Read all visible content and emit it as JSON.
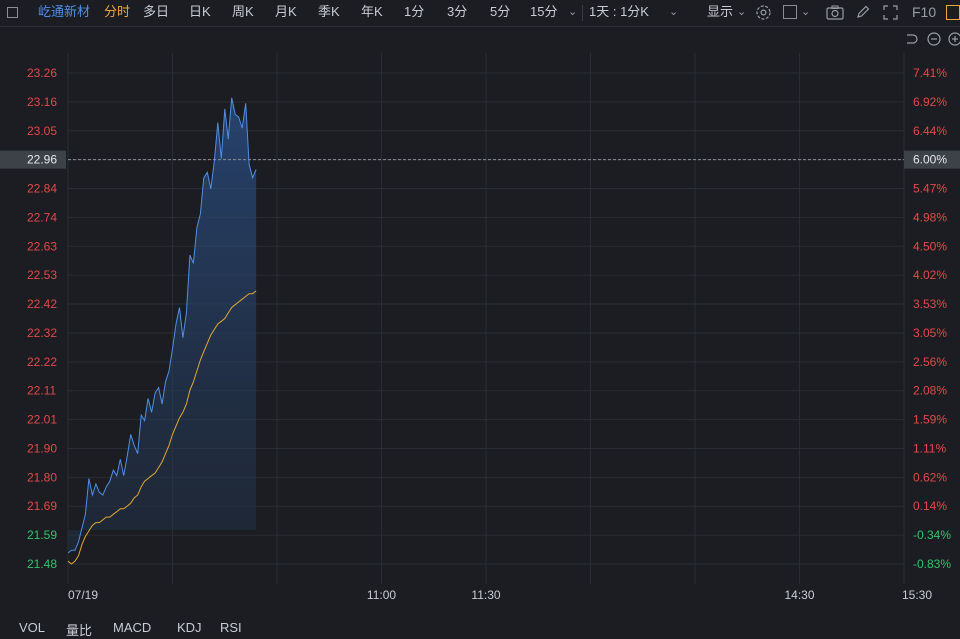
{
  "toolbar": {
    "stock_name": "屹通新材",
    "periods": [
      "分时",
      "多日",
      "日K",
      "周K",
      "月K",
      "季K",
      "年K",
      "1分",
      "3分",
      "5分",
      "15分"
    ],
    "range_select": "1天 : 1分K",
    "display_label": "显示",
    "f10_label": "F10"
  },
  "colors": {
    "background": "#1b1d22",
    "price_line": "#4f8ee8",
    "avg_line": "#e3a72f",
    "up_text": "#e54848",
    "down_text": "#32c36c",
    "active_tab": "#f0a63a",
    "stock_name": "#4f8ee8"
  },
  "chart_data": {
    "type": "line",
    "prev_close": 21.66,
    "y_ticks_left": [
      "23.26",
      "23.16",
      "23.05",
      "22.96",
      "22.84",
      "22.74",
      "22.63",
      "22.53",
      "22.42",
      "22.32",
      "22.22",
      "22.11",
      "22.01",
      "21.90",
      "21.80",
      "21.69",
      "21.59",
      "21.48"
    ],
    "y_ticks_right": [
      "7.41%",
      "6.92%",
      "6.44%",
      "6.00%",
      "5.47%",
      "4.98%",
      "4.50%",
      "4.02%",
      "3.53%",
      "3.05%",
      "2.56%",
      "2.08%",
      "1.59%",
      "1.11%",
      "0.62%",
      "0.14%",
      "-0.34%",
      "-0.83%"
    ],
    "current_price_label": "22.96",
    "current_pct_label": "6.00%",
    "ylim": [
      21.48,
      23.26
    ],
    "x_ticks": [
      "07/19",
      "11:00",
      "11:30",
      "14:30",
      "15:30"
    ],
    "session_minutes": 240,
    "series": [
      {
        "values": [
          21.52,
          21.53,
          21.53,
          21.56,
          21.61,
          21.66,
          21.79,
          21.73,
          21.77,
          21.74,
          21.73,
          21.76,
          21.78,
          21.82,
          21.8,
          21.86,
          21.8,
          21.87,
          21.95,
          21.91,
          21.88,
          22.02,
          22.0,
          22.08,
          22.03,
          22.1,
          22.12,
          22.06,
          22.14,
          22.18,
          22.26,
          22.35,
          22.41,
          22.3,
          22.39,
          22.6,
          22.57,
          22.7,
          22.75,
          22.88,
          22.9,
          22.84,
          22.94,
          23.08,
          22.95,
          23.13,
          23.02,
          23.17,
          23.11,
          23.1,
          23.06,
          23.15,
          22.93,
          22.88,
          22.91
        ]
      },
      {
        "values": [
          21.49,
          21.48,
          21.49,
          21.51,
          21.55,
          21.58,
          21.6,
          21.62,
          21.63,
          21.63,
          21.64,
          21.65,
          21.65,
          21.66,
          21.67,
          21.68,
          21.68,
          21.69,
          21.7,
          21.72,
          21.73,
          21.76,
          21.78,
          21.79,
          21.8,
          21.81,
          21.83,
          21.85,
          21.88,
          21.91,
          21.95,
          21.98,
          22.01,
          22.03,
          22.06,
          22.11,
          22.14,
          22.18,
          22.22,
          22.25,
          22.28,
          22.31,
          22.33,
          22.35,
          22.36,
          22.37,
          22.39,
          22.41,
          22.42,
          22.43,
          22.44,
          22.45,
          22.46,
          22.46,
          22.47
        ]
      }
    ],
    "grid": true
  },
  "bottom_tabs": [
    "VOL",
    "量比",
    "MACD",
    "KDJ",
    "RSI"
  ]
}
